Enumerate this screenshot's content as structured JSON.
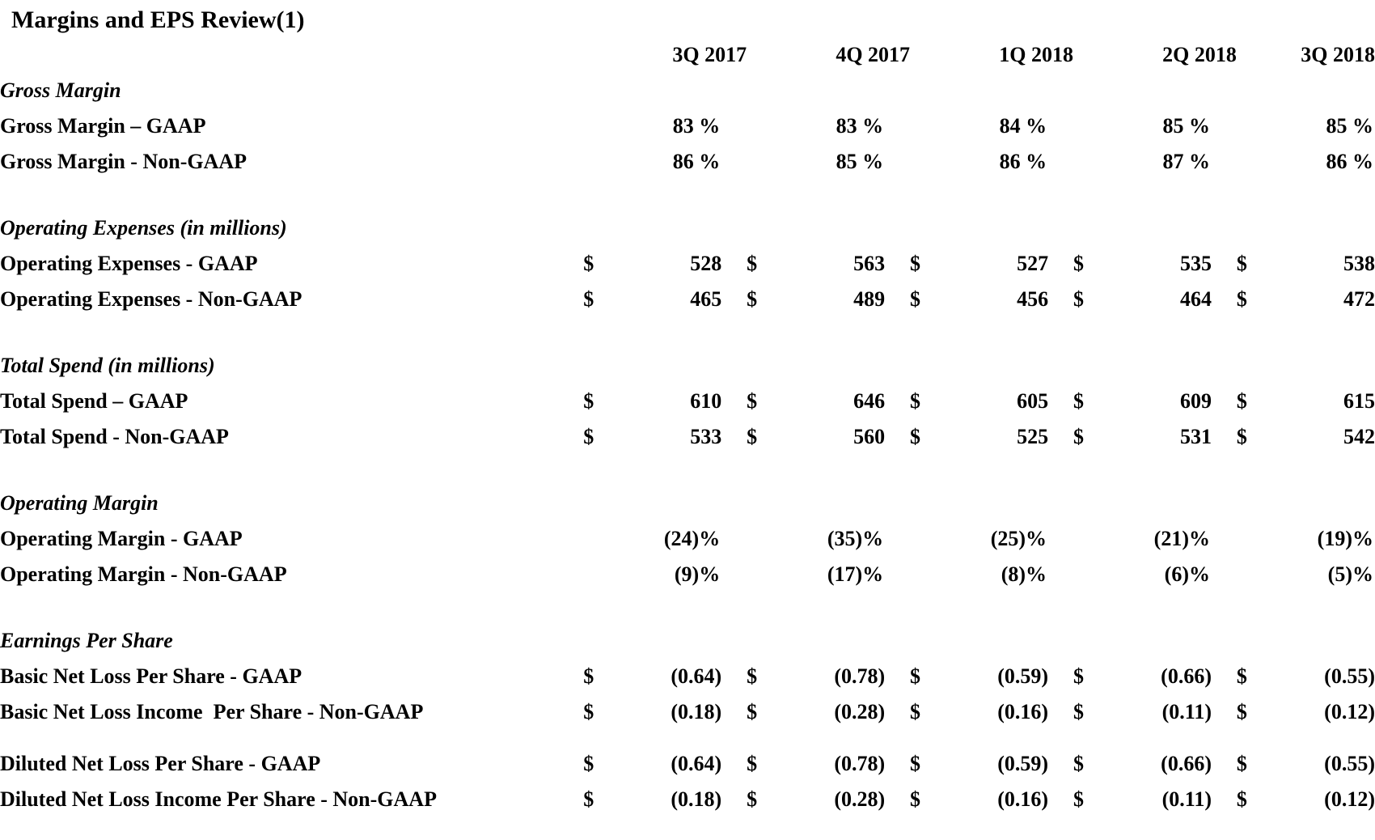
{
  "title": "Margins and EPS Review(1)",
  "columns": [
    "3Q 2017",
    "4Q 2017",
    "1Q 2018",
    "2Q 2018",
    "3Q 2018"
  ],
  "currency_symbol": "$",
  "sections": [
    {
      "heading": "Gross Margin",
      "rows": [
        {
          "label": "Gross Margin – GAAP",
          "values": [
            "83 %",
            "83 %",
            "84 %",
            "85 %",
            "85 %"
          ]
        },
        {
          "label": "Gross Margin - Non-GAAP",
          "values": [
            "86 %",
            "85 %",
            "86 %",
            "87 %",
            "86 %"
          ]
        }
      ]
    },
    {
      "heading": "Operating Expenses (in millions)",
      "rows": [
        {
          "label": "Operating Expenses - GAAP",
          "values": [
            "528",
            "563",
            "527",
            "535",
            "538"
          ]
        },
        {
          "label": "Operating Expenses - Non-GAAP",
          "values": [
            "465",
            "489",
            "456",
            "464",
            "472"
          ]
        }
      ]
    },
    {
      "heading": "Total Spend (in millions)",
      "rows": [
        {
          "label": "Total Spend – GAAP",
          "values": [
            "610",
            "646",
            "605",
            "609",
            "615"
          ]
        },
        {
          "label": "Total Spend - Non-GAAP",
          "values": [
            "533",
            "560",
            "525",
            "531",
            "542"
          ]
        }
      ]
    },
    {
      "heading": "Operating Margin",
      "rows": [
        {
          "label": "Operating Margin - GAAP",
          "values": [
            "(24)%",
            "(35)%",
            "(25)%",
            "(21)%",
            "(19)%"
          ]
        },
        {
          "label": "Operating Margin - Non-GAAP",
          "values": [
            "(9)%",
            "(17)%",
            "(8)%",
            "(6)%",
            "(5)%"
          ]
        }
      ]
    },
    {
      "heading": "Earnings Per Share",
      "rows": [
        {
          "label": "Basic Net Loss Per Share - GAAP",
          "values": [
            "(0.64)",
            "(0.78)",
            "(0.59)",
            "(0.66)",
            "(0.55)"
          ]
        },
        {
          "label": "Basic Net Loss Income  Per Share - Non-GAAP",
          "values": [
            "(0.18)",
            "(0.28)",
            "(0.16)",
            "(0.11)",
            "(0.12)"
          ]
        },
        {
          "label": "Diluted Net Loss Per Share - GAAP",
          "values": [
            "(0.64)",
            "(0.78)",
            "(0.59)",
            "(0.66)",
            "(0.55)"
          ]
        },
        {
          "label": "Diluted Net Loss Income Per Share - Non-GAAP",
          "values": [
            "(0.18)",
            "(0.28)",
            "(0.16)",
            "(0.11)",
            "(0.12)"
          ]
        }
      ]
    }
  ]
}
